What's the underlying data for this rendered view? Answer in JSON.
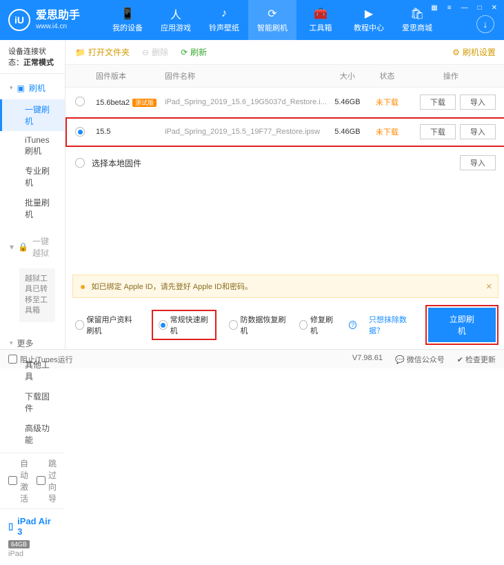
{
  "brand": {
    "title": "爱思助手",
    "subtitle": "www.i4.cn",
    "logo_letter": "iU"
  },
  "window_controls": [
    "▦",
    "≡",
    "—",
    "□",
    "✕"
  ],
  "nav": [
    {
      "label": "我的设备",
      "icon": "📱"
    },
    {
      "label": "应用游戏",
      "icon": "人"
    },
    {
      "label": "铃声壁纸",
      "icon": "♪"
    },
    {
      "label": "智能刷机",
      "icon": "⟳",
      "active": true
    },
    {
      "label": "工具箱",
      "icon": "🧰"
    },
    {
      "label": "教程中心",
      "icon": "▶"
    },
    {
      "label": "爱思商城",
      "icon": "🛍"
    }
  ],
  "connection": {
    "label": "设备连接状态：",
    "value": "正常模式"
  },
  "sidebar": {
    "group_flash": {
      "title": "刷机",
      "items": [
        "一键刷机",
        "iTunes刷机",
        "专业刷机",
        "批量刷机"
      ],
      "active_index": 0
    },
    "group_jb": {
      "title": "一键越狱",
      "note": "越狱工具已转移至工具箱"
    },
    "group_more": {
      "title": "更多",
      "items": [
        "其他工具",
        "下载固件",
        "高级功能"
      ]
    },
    "auto_activate": "自动激活",
    "skip_guide": "跳过向导",
    "device": {
      "name": "iPad Air 3",
      "storage": "64GB",
      "type": "iPad"
    }
  },
  "toolbar": {
    "open_folder": "打开文件夹",
    "delete": "删除",
    "refresh": "刷新",
    "settings": "刷机设置"
  },
  "columns": {
    "version": "固件版本",
    "name": "固件名称",
    "size": "大小",
    "status": "状态",
    "ops": "操作"
  },
  "firmware": [
    {
      "version": "15.6beta2",
      "beta": "测试版",
      "name": "iPad_Spring_2019_15.6_19G5037d_Restore.i...",
      "size": "5.46GB",
      "status": "未下载",
      "selected": false
    },
    {
      "version": "15.5",
      "beta": "",
      "name": "iPad_Spring_2019_15.5_19F77_Restore.ipsw",
      "size": "5.46GB",
      "status": "未下载",
      "selected": true
    }
  ],
  "btn": {
    "download": "下载",
    "import": "导入"
  },
  "local_firmware": "选择本地固件",
  "warning": "如已绑定 Apple ID，请先登好 Apple ID和密码。",
  "modes": {
    "m1": "保留用户资料刷机",
    "m2": "常规快速刷机",
    "m3": "防数据恢复刷机",
    "m4": "修复刷机",
    "exclude_link": "只想抹除数据？",
    "flash_now": "立即刷机"
  },
  "statusbar": {
    "block_itunes": "阻止iTunes运行",
    "version": "V7.98.61",
    "wechat": "微信公众号",
    "check_update": "检查更新"
  }
}
